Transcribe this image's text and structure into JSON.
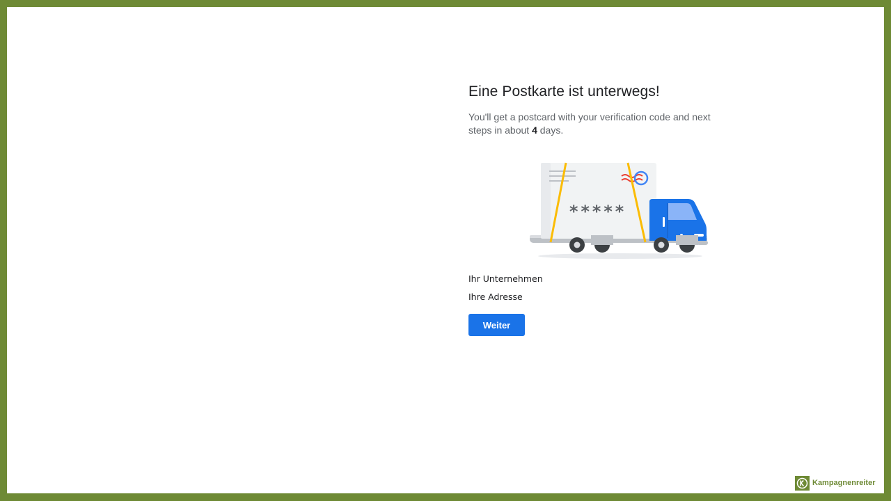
{
  "page": {
    "title": "Eine Postkarte ist unterwegs!",
    "subtitle_before": "You'll get a postcard with your verification code and next steps in about ",
    "subtitle_days": "4",
    "subtitle_after": " days.",
    "illustration": {
      "icon": "delivery-truck-postcard-illustration",
      "code_mask": "*****"
    },
    "business_name": "Ihr Unternehmen",
    "address": "Ihre Adresse",
    "next_button_label": "Weiter"
  },
  "branding": {
    "name": "Kampagnenreiter",
    "logo_letter": "K"
  },
  "colors": {
    "frame": "#6e8a35",
    "primary_button": "#1a73e8",
    "title_text": "#202124",
    "body_text": "#5f6368"
  }
}
